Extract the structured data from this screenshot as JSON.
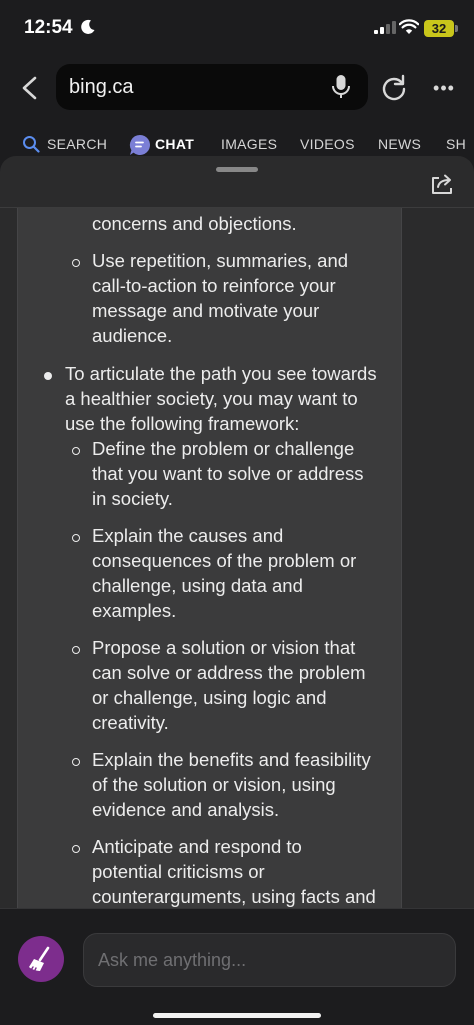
{
  "status_bar": {
    "time": "12:54",
    "battery": "32",
    "icons": [
      "moon-icon",
      "signal-icon",
      "wifi-icon",
      "battery-icon"
    ]
  },
  "browser": {
    "url": "bing.ca",
    "icons": [
      "back-icon",
      "mic-icon",
      "reload-icon",
      "more-icon"
    ]
  },
  "tabs": [
    {
      "label": "SEARCH"
    },
    {
      "label": "CHAT",
      "active": true
    },
    {
      "label": "IMAGES"
    },
    {
      "label": "VIDEOS"
    },
    {
      "label": "NEWS"
    },
    {
      "label": "SH"
    }
  ],
  "chat": {
    "lines": [
      "concerns and objections.",
      "Use repetition, summaries, and",
      "call-to-action to reinforce your",
      "message and motivate your",
      "audience.",
      "To articulate the path you see towards",
      "a healthier society, you may want to",
      "use the following framework:",
      "Define the problem or challenge",
      "that you want to solve or address",
      "in society.",
      "Explain the causes and",
      "consequences of the problem or",
      "challenge, using data and",
      "examples.",
      "Propose a solution or vision that",
      "can solve or address the problem",
      "or challenge, using logic and",
      "creativity.",
      "Explain the benefits and feasibility",
      "of the solution or vision, using",
      "evidence and analysis.",
      "Anticipate and respond to",
      "potential criticisms or",
      "counterarguments, using facts and"
    ]
  },
  "composer": {
    "placeholder": "Ask me anything...",
    "icons": [
      "broom-icon",
      "share-icon"
    ]
  },
  "colors": {
    "accent": "#7d2d8d",
    "battery": "#c9c61b",
    "card_bg": "#3b3b3c",
    "sheet_bg": "#2b2b2c"
  }
}
